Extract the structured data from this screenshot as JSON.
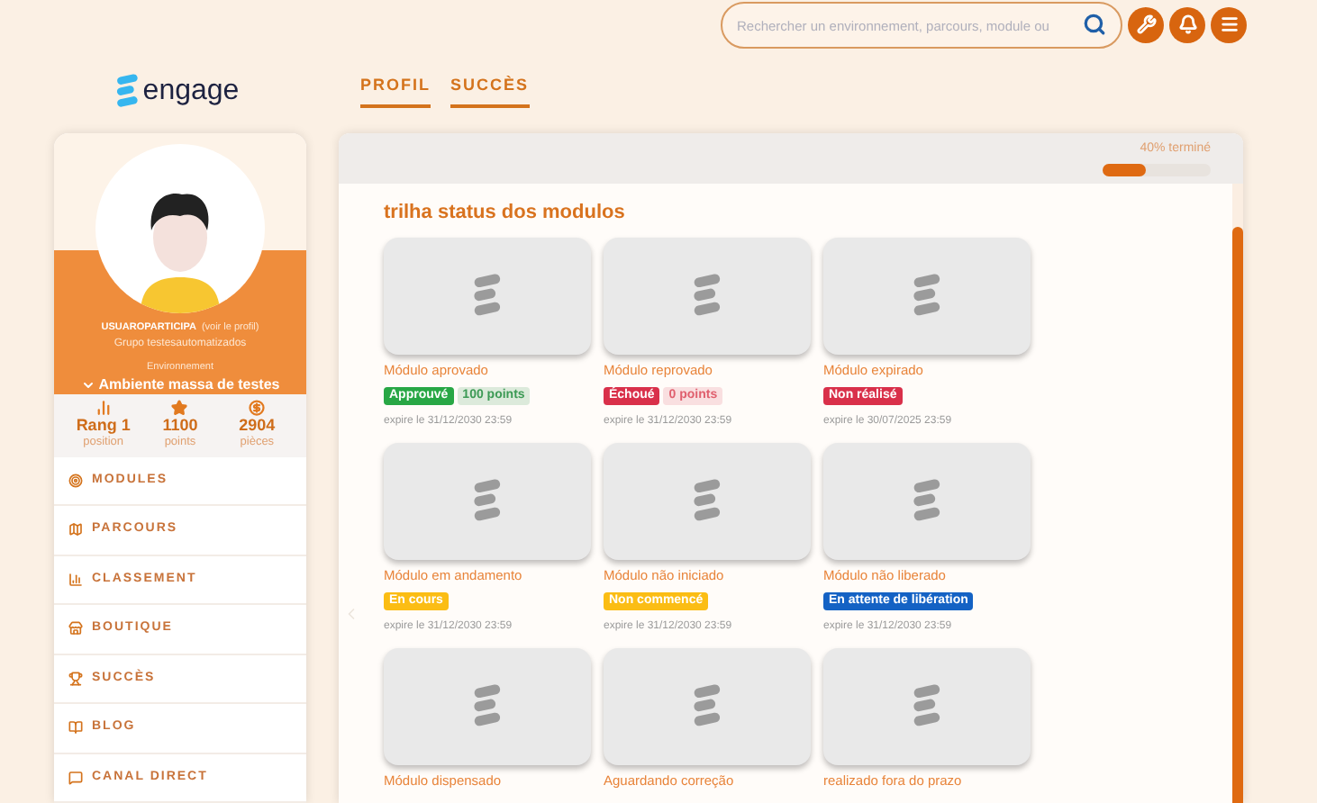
{
  "header": {
    "search": {
      "placeholder": "Rechercher un environnement, parcours, module ou"
    },
    "logo": "engage",
    "tabs": [
      {
        "label": "PROFIL",
        "selected": true
      },
      {
        "label": "SUCCÈS",
        "selected": true
      }
    ]
  },
  "sidebar": {
    "user": "USUAROPARTICIPA",
    "profile_link": "(voir le profil)",
    "group": "Grupo testesautomatizados",
    "environment_label": "Environnement",
    "environment": "Ambiente massa de testes",
    "stats": [
      {
        "kind": "rank",
        "value": "Rang 1",
        "label": "position"
      },
      {
        "kind": "points",
        "value": "1100",
        "label": "points"
      },
      {
        "kind": "coins",
        "value": "2904",
        "label": "pièces"
      }
    ],
    "menu": [
      {
        "kind": "modules",
        "label": "MODULES"
      },
      {
        "kind": "parcours",
        "label": "PARCOURS"
      },
      {
        "kind": "classement",
        "label": "CLASSEMENT"
      },
      {
        "kind": "boutique",
        "label": "BOUTIQUE"
      },
      {
        "kind": "succes",
        "label": "SUCCÈS"
      },
      {
        "kind": "blog",
        "label": "BLOG"
      },
      {
        "kind": "canal",
        "label": "CANAL DIRECT"
      }
    ]
  },
  "main": {
    "progress": {
      "text": "40% terminé",
      "level": 0.4
    },
    "title": "trilha status dos modulos",
    "modules": [
      {
        "title": "Módulo aprovado",
        "badges": [
          {
            "kind": "status",
            "text": "Approuvé",
            "color": "#28a745"
          },
          {
            "kind": "points",
            "text": "100 points",
            "color": "#3d9a55"
          }
        ],
        "expiry": "expire le 31/12/2030 23:59"
      },
      {
        "title": "Módulo reprovado",
        "badges": [
          {
            "kind": "status",
            "text": "Échoué",
            "color": "#d9304a"
          },
          {
            "kind": "points",
            "text": "0 points",
            "color": "#e0606e"
          }
        ],
        "expiry": "expire le 31/12/2030 23:59"
      },
      {
        "title": "Módulo expirado",
        "badges": [
          {
            "kind": "status",
            "text": "Non réalisé",
            "color": "#d9304a"
          }
        ],
        "expiry": "expire le 30/07/2025 23:59"
      },
      {
        "title": "Módulo em andamento",
        "badges": [
          {
            "kind": "status",
            "text": "En cours",
            "color": "#fbbd14"
          }
        ],
        "expiry": "expire le 31/12/2030 23:59"
      },
      {
        "title": "Módulo não iniciado",
        "badges": [
          {
            "kind": "status",
            "text": "Non commencé",
            "color": "#fbbd14"
          }
        ],
        "expiry": "expire le 31/12/2030 23:59"
      },
      {
        "title": "Módulo não liberado",
        "badges": [
          {
            "kind": "status",
            "text": "En attente de libération",
            "color": "#1462c4"
          }
        ],
        "expiry": "expire le 31/12/2030 23:59"
      },
      {
        "title": "Módulo dispensado"
      },
      {
        "title": "Aguardando correção"
      },
      {
        "title": "realizado fora do prazo"
      }
    ]
  }
}
